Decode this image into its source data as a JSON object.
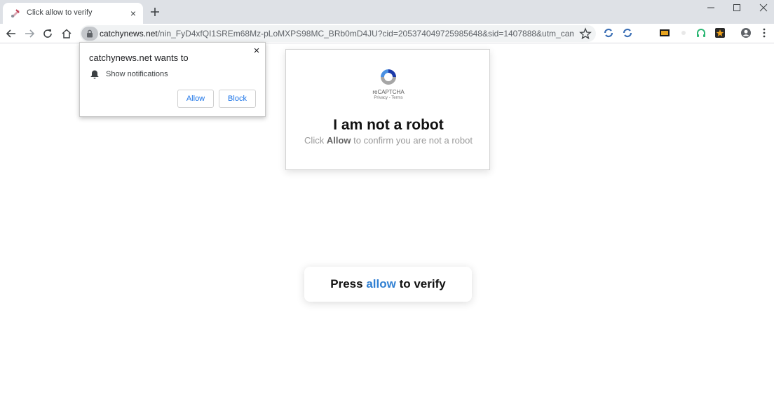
{
  "browser": {
    "tab": {
      "title": "Click allow to verify",
      "close_glyph": "×"
    },
    "new_tab_glyph": "+",
    "window_controls": [
      "minimize-icon",
      "maximize-icon",
      "close-icon"
    ],
    "toolbar": {
      "icons": [
        "back-arrow-icon",
        "forward-arrow-icon",
        "reload-icon",
        "home-icon"
      ]
    },
    "omnibox": {
      "host": "catchynews.net",
      "path": "/nin_FyD4xfQI1SREm68Mz-pLoMXPS98MC_BRb0mD4JU?cid=205374049725985648&sid=1407888&utm_campaign..."
    },
    "extensions": [
      "sync-icon",
      "sync-icon",
      "imdb-extension-icon",
      "star-extension-icon",
      "headphones-icon",
      "star-badge-icon",
      "account-icon",
      "more-menu-icon"
    ]
  },
  "notification_prompt": {
    "title": "catchynews.net wants to",
    "permission": "Show notifications",
    "allow_label": "Allow",
    "block_label": "Block",
    "close_glyph": "×"
  },
  "captcha": {
    "brand": "reCAPTCHA",
    "links": "Privacy - Terms",
    "heading": "I am not a robot",
    "sub_prefix": "Click",
    "sub_emphasis": "Allow",
    "sub_suffix": "to confirm you are not a robot"
  },
  "press_card": {
    "prefix": "Press",
    "accent": "allow",
    "suffix": "to verify"
  },
  "colors": {
    "tabstrip": "#dee1e6",
    "button_text": "#1a73e8",
    "accent": "#2f7fd2"
  }
}
